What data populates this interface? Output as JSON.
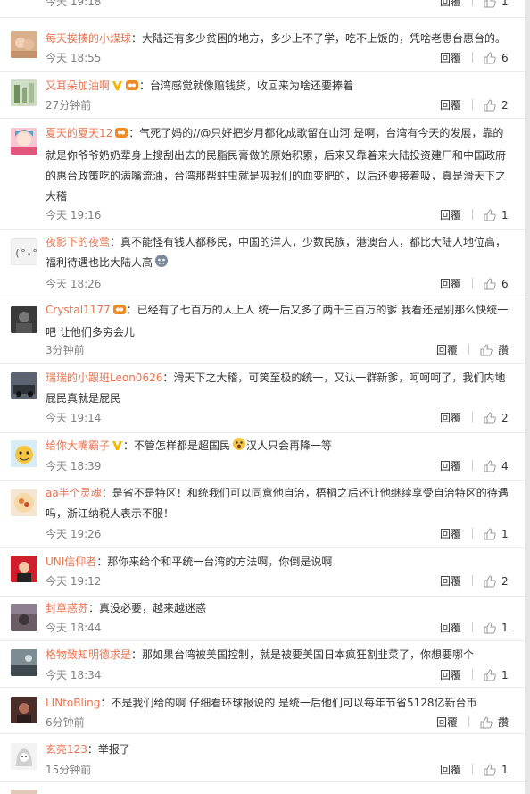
{
  "labels": {
    "reply": "回覆",
    "like_zh": "讚"
  },
  "colors": {
    "username": "#eb7350",
    "text": "#333333",
    "time": "#808080"
  },
  "partial_top": {
    "time": "今天 19:18",
    "likes": "1"
  },
  "comments": [
    {
      "user": "每天挨揍的小煤球",
      "text": "：大陆还有多少贫困的地方，多少上不了学，吃不上饭的，凭啥老惠台惠台的。",
      "time": "今天 18:55",
      "likes": "6"
    },
    {
      "user": "又耳朵加油啊",
      "text": "：台湾感觉就像赔钱货，收回来为啥还要捧着",
      "time": "27分钟前",
      "likes": "2"
    },
    {
      "user": "夏天的夏天12",
      "text": "：气死了妈的//@只好把岁月都化成歌留在山河:是啊，台湾有今天的发展，靠的就是你爷爷奶奶辈身上搜刮出去的民脂民膏做的原始积累，后来又靠着来大陆投资建厂和中国政府的惠台政策吃的满嘴流油，台湾那帮蛀虫就是吸我们的血变肥的，以后还要接着吸，真是滑天下之大稽",
      "time": "今天 19:16",
      "likes": "1"
    },
    {
      "user": "夜影下的夜莺",
      "text": "：真不能怪有钱人都移民，中国的洋人，少数民族，港澳台人，都比大陆人地位高，福利待遇也比大陆人高",
      "time": "今天 18:26",
      "likes": "6"
    },
    {
      "user": "Crystal1177",
      "text": "：已经有了七百万的人上人 统一后又多了两千三百万的爹 我看还是别那么快统一吧 让他们多穷会儿",
      "time": "3分钟前",
      "likes": "讚"
    },
    {
      "user": "瑞瑞的小跟班Leon0626",
      "text": "：滑天下之大稽，可笑至极的统一，又认一群新爹，呵呵呵了，我们内地屁民真就是屁民",
      "time": "今天 19:14",
      "likes": "2"
    },
    {
      "user": "给你大嘴霸子",
      "text": "：不管怎样都是超国民",
      "text2": "汉人只会再降一等",
      "time": "今天 18:39",
      "likes": "4"
    },
    {
      "user": "aa半个灵魂",
      "text": "：是省不是特区！和统我们可以同意他自治，梧桐之后还让他继续享受自治特区的待遇吗，浙江纳税人表示不服！",
      "time": "今天 19:26",
      "likes": "1"
    },
    {
      "user": "UNI信仰者",
      "text": "：那你来给个和平统一台湾的方法啊，你倒是说啊",
      "time": "今天 19:12",
      "likes": "2"
    },
    {
      "user": "封章惑苏",
      "text": "：真没必要，越来越迷惑",
      "time": "今天 18:44",
      "likes": "1"
    },
    {
      "user": "格物致知明德求是",
      "text": "：那如果台湾被美国控制，就是被要美国日本疯狂割韭菜了，你想要哪个",
      "time": "今天 18:34",
      "likes": "1"
    },
    {
      "user": "LINtoBling",
      "text": "：不是我们给的啊 仔细看环球报说的 是统一后他们可以每年节省5128亿新台币",
      "time": "6分钟前",
      "likes": "讚"
    },
    {
      "user": "玄亮123",
      "text": "：举报了",
      "time": "15分钟前",
      "likes": "1"
    }
  ]
}
